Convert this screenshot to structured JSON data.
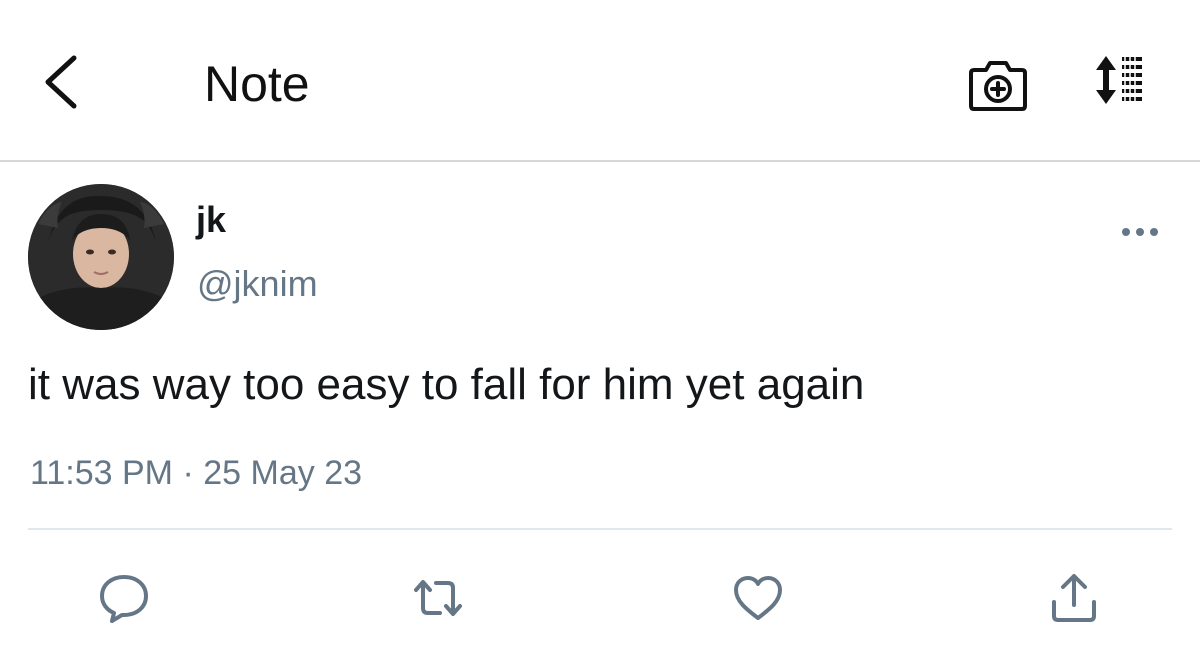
{
  "header": {
    "title": "Note",
    "icons": {
      "back": "chevron-left-icon",
      "camera": "camera-add-icon",
      "sort": "sort-list-icon"
    }
  },
  "tweet": {
    "author_name": "jk",
    "author_handle": "@jknim",
    "text": "it was way too easy to fall for him yet again",
    "timestamp": "11:53 PM",
    "separator": "·",
    "date": "25 May 23"
  },
  "actions": [
    {
      "name": "reply",
      "icon": "comment-icon"
    },
    {
      "name": "retweet",
      "icon": "retweet-icon"
    },
    {
      "name": "like",
      "icon": "heart-icon"
    },
    {
      "name": "share",
      "icon": "share-icon"
    }
  ],
  "colors": {
    "text_primary": "#14171a",
    "text_secondary": "#657786",
    "icon": "#657786",
    "divider": "#e1e8ed"
  }
}
